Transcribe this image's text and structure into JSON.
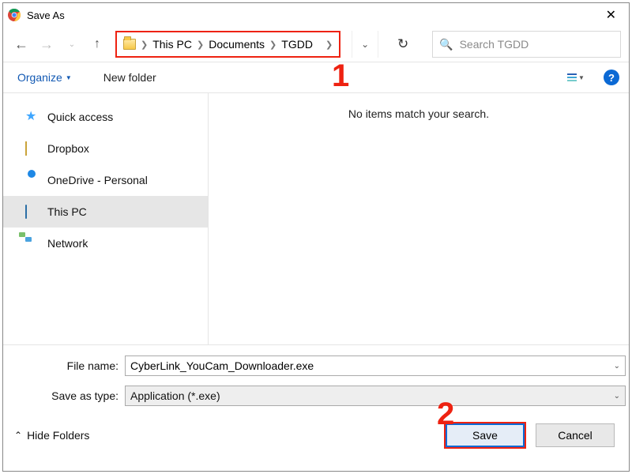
{
  "window": {
    "title": "Save As"
  },
  "nav": {
    "breadcrumbs": [
      "This PC",
      "Documents",
      "TGDD"
    ],
    "search_placeholder": "Search TGDD"
  },
  "toolbar": {
    "organize": "Organize",
    "new_folder": "New folder"
  },
  "sidebar": {
    "items": [
      {
        "label": "Quick access"
      },
      {
        "label": "Dropbox"
      },
      {
        "label": "OneDrive - Personal"
      },
      {
        "label": "This PC"
      },
      {
        "label": "Network"
      }
    ],
    "selected_index": 3
  },
  "content": {
    "empty_message": "No items match your search."
  },
  "form": {
    "file_name_label": "File name:",
    "file_name_value": "CyberLink_YouCam_Downloader.exe",
    "save_type_label": "Save as type:",
    "save_type_value": "Application (*.exe)"
  },
  "footer": {
    "hide_folders": "Hide Folders",
    "save": "Save",
    "cancel": "Cancel"
  },
  "annotations": {
    "one": "1",
    "two": "2"
  }
}
